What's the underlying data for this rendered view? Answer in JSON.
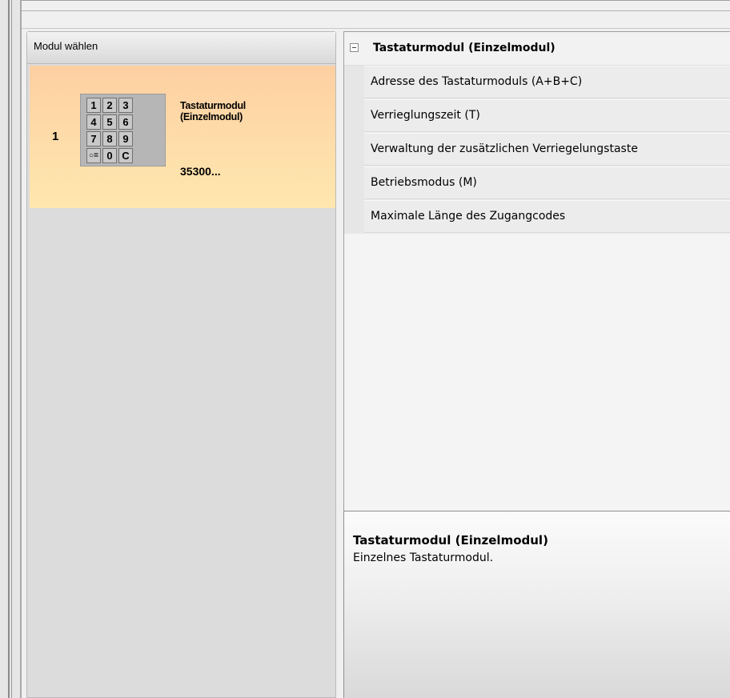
{
  "module_panel": {
    "title": "Modul wählen",
    "module": {
      "index": "1",
      "name_line1": "Tastaturmodul",
      "name_line2": "(Einzelmodul)",
      "code": "35300...",
      "keypad_keys": [
        "1",
        "2",
        "3",
        "4",
        "5",
        "6",
        "7",
        "8",
        "9",
        "○=",
        "0",
        "C"
      ]
    }
  },
  "property_grid": {
    "category": "Tastaturmodul (Einzelmodul)",
    "collapse_icon": "minus-box-icon",
    "properties": [
      "Adresse des Tastaturmoduls (A+B+C)",
      "Verrieglungszeit (T)",
      "Verwaltung der zusätzlichen Verriegelungstaste",
      "Betriebsmodus (M)",
      "Maximale Länge des Zugangcodes"
    ]
  },
  "description": {
    "title": "Tastaturmodul (Einzelmodul)",
    "text": "Einzelnes Tastaturmodul."
  },
  "colors": {
    "card_top": "#fdcfa2",
    "card_bottom": "#ffe7ae",
    "panel_bg": "#dcdcdc"
  }
}
